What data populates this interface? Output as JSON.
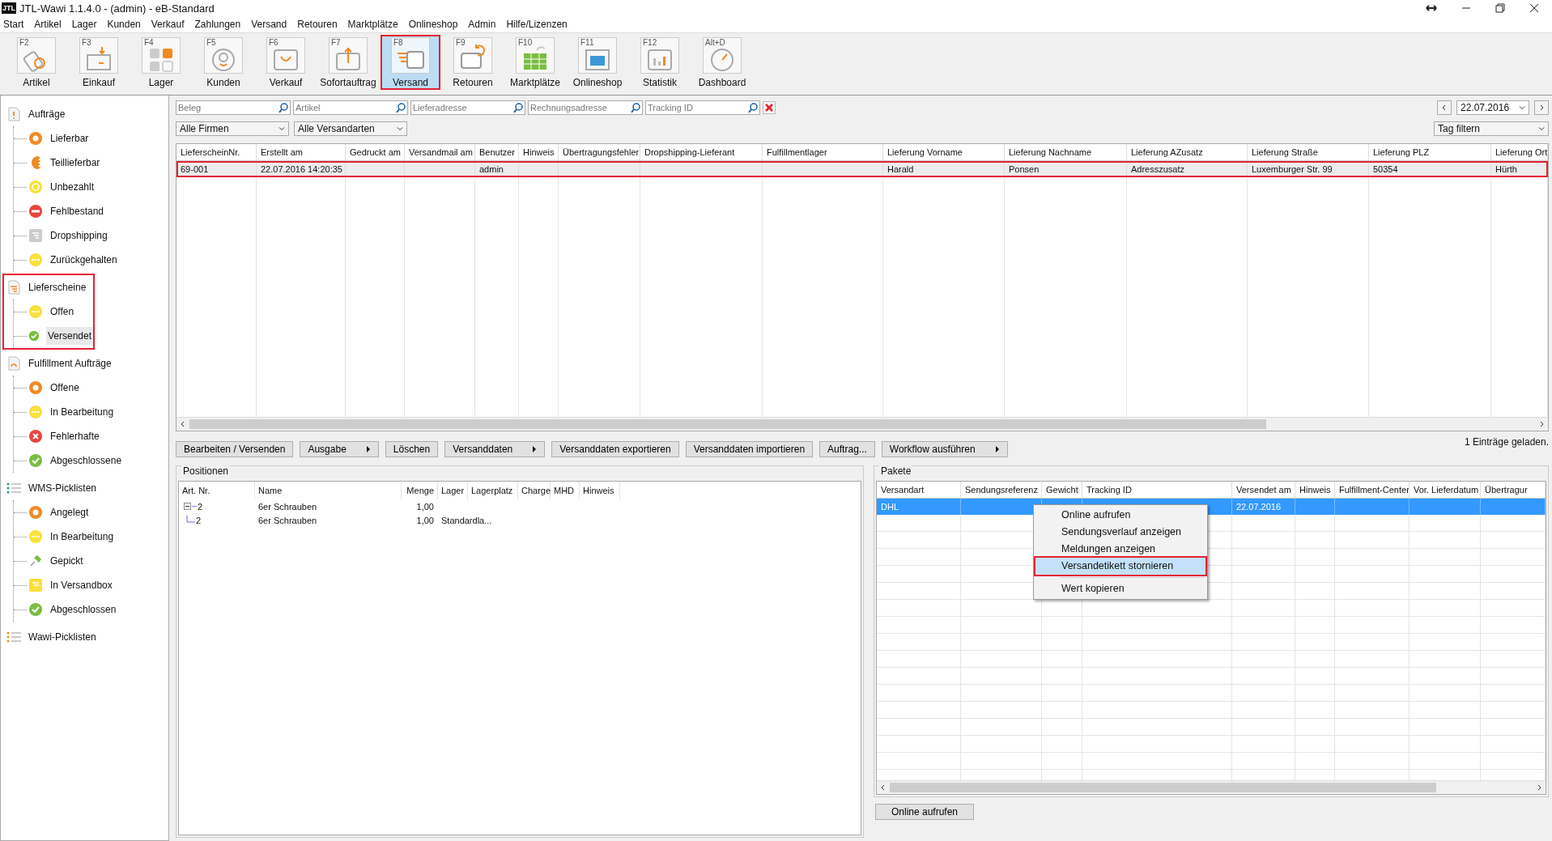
{
  "window": {
    "title": "JTL-Wawi 1.1.4.0 - (admin) - eB-Standard",
    "logo": "JTL"
  },
  "menu": [
    "Start",
    "Artikel",
    "Lager",
    "Kunden",
    "Verkauf",
    "Zahlungen",
    "Versand",
    "Retouren",
    "Marktplätze",
    "Onlineshop",
    "Admin",
    "Hilfe/Lizenzen"
  ],
  "toolbar": [
    {
      "key": "F2",
      "label": "Artikel",
      "selected": false,
      "highlighted": false
    },
    {
      "key": "F3",
      "label": "Einkauf",
      "selected": false,
      "highlighted": false
    },
    {
      "key": "F4",
      "label": "Lager",
      "selected": false,
      "highlighted": false
    },
    {
      "key": "F5",
      "label": "Kunden",
      "selected": false,
      "highlighted": false
    },
    {
      "key": "F6",
      "label": "Verkauf",
      "selected": false,
      "highlighted": false
    },
    {
      "key": "F7",
      "label": "Sofortauftrag",
      "selected": false,
      "highlighted": false
    },
    {
      "key": "F8",
      "label": "Versand",
      "selected": true,
      "highlighted": true
    },
    {
      "key": "F9",
      "label": "Retouren",
      "selected": false,
      "highlighted": false
    },
    {
      "key": "F10",
      "label": "Marktplätze",
      "selected": false,
      "highlighted": false
    },
    {
      "key": "F11",
      "label": "Onlineshop",
      "selected": false,
      "highlighted": false
    },
    {
      "key": "F12",
      "label": "Statistik",
      "selected": false,
      "highlighted": false
    },
    {
      "key": "Alt+D",
      "label": "Dashboard",
      "selected": false,
      "highlighted": false
    }
  ],
  "sidebar": [
    {
      "label": "Aufträge",
      "kind": "doc-alert",
      "highlighted": false,
      "children": [
        {
          "label": "Lieferbar",
          "kind": "ring-orange",
          "selected": false
        },
        {
          "label": "Teillieferbar",
          "kind": "half-orange",
          "selected": false
        },
        {
          "label": "Unbezahlt",
          "kind": "euro-yellow",
          "selected": false
        },
        {
          "label": "Fehlbestand",
          "kind": "minus-red",
          "selected": false
        },
        {
          "label": "Dropshipping",
          "kind": "dropship-gray",
          "selected": false
        },
        {
          "label": "Zurückgehalten",
          "kind": "dots-yellow",
          "selected": false
        }
      ]
    },
    {
      "label": "Lieferscheine",
      "kind": "doc-lines",
      "highlighted": true,
      "children": [
        {
          "label": "Offen",
          "kind": "dots-yellow",
          "selected": false
        },
        {
          "label": "Versendet",
          "kind": "check-green",
          "selected": true
        }
      ]
    },
    {
      "label": "Fulfillment Aufträge",
      "kind": "doc-return",
      "highlighted": false,
      "children": [
        {
          "label": "Offene",
          "kind": "ring-orange",
          "selected": false
        },
        {
          "label": "In Bearbeitung",
          "kind": "dots-yellow",
          "selected": false
        },
        {
          "label": "Fehlerhafte",
          "kind": "cross-red",
          "selected": false
        },
        {
          "label": "Abgeschlossene",
          "kind": "check-green",
          "selected": false
        }
      ]
    },
    {
      "label": "WMS-Picklisten",
      "kind": "list-teal",
      "highlighted": false,
      "children": [
        {
          "label": "Angelegt",
          "kind": "ring-orange",
          "selected": false
        },
        {
          "label": "In Bearbeitung",
          "kind": "dots-yellow",
          "selected": false
        },
        {
          "label": "Gepickt",
          "kind": "pin-green",
          "selected": false
        },
        {
          "label": "In Versandbox",
          "kind": "box-yellow",
          "selected": false
        },
        {
          "label": "Abgeschlossen",
          "kind": "check-green",
          "selected": false
        }
      ]
    },
    {
      "label": "Wawi-Picklisten",
      "kind": "list-orange",
      "highlighted": false
    }
  ],
  "filters": {
    "search": [
      {
        "placeholder": "Beleg"
      },
      {
        "placeholder": "Artikel"
      },
      {
        "placeholder": "Lieferadresse"
      },
      {
        "placeholder": "Rechnungsadresse"
      },
      {
        "placeholder": "Tracking ID"
      }
    ],
    "dropdowns": [
      "Alle Firmen",
      "Alle Versandarten"
    ],
    "date": "22.07.2016",
    "date_filter": "Tag filtern"
  },
  "orders": {
    "columns": [
      "LieferscheinNr.",
      "Erstellt am",
      "Gedruckt am",
      "Versandmail am",
      "Benutzer",
      "Hinweis",
      "Übertragungsfehler",
      "Dropshipping-Lieferant",
      "Fulfillmentlager",
      "Lieferung Vorname",
      "Lieferung Nachname",
      "Lieferung AZusatz",
      "Lieferung Straße",
      "Lieferung PLZ",
      "Lieferung Ort"
    ],
    "rows": [
      {
        "highlighted": true,
        "cells": [
          "69-001",
          "22.07.2016 14:20:35",
          "",
          "",
          "admin",
          "",
          "",
          "",
          "",
          "Harald",
          "Ponsen",
          "Adresszusatz",
          "Luxemburger Str. 99",
          "50354",
          "Hürth"
        ]
      }
    ]
  },
  "actions": [
    {
      "label": "Bearbeiten / Versenden",
      "kind": "plain"
    },
    {
      "label": "Ausgabe",
      "kind": "menu"
    },
    {
      "label": "Löschen",
      "kind": "plain"
    },
    {
      "label": "Versanddaten",
      "kind": "menu"
    },
    {
      "label": "Versanddaten exportieren",
      "kind": "plain"
    },
    {
      "label": "Versanddaten importieren",
      "kind": "plain"
    },
    {
      "label": "Auftrag...",
      "kind": "plain"
    },
    {
      "label": "Workflow ausführen",
      "kind": "menu"
    }
  ],
  "status": "1 Einträge geladen.",
  "positions": {
    "title": "Positionen",
    "columns": [
      "Art. Nr.",
      "Name",
      "Menge",
      "Lager",
      "Lagerplatz",
      "Charge",
      "MHD",
      "Hinweis"
    ],
    "rows": [
      {
        "cells": [
          "2",
          "6er Schrauben",
          "1,00",
          "",
          "",
          "",
          "",
          ""
        ],
        "expanded": true,
        "children": [
          {
            "cells": [
              "2",
              "6er Schrauben",
              "1,00",
              "Standardla...",
              "",
              "",
              "",
              ""
            ]
          }
        ]
      }
    ]
  },
  "packages": {
    "title": "Pakete",
    "columns": [
      "Versandart",
      "Sendungsreferenz",
      "Gewicht",
      "Tracking ID",
      "Versendet am",
      "Hinweis",
      "Fulfillment-Center",
      "Vor. Lieferdatum",
      "Übertragur"
    ],
    "rows": [
      {
        "selected": true,
        "cells": [
          "DHL",
          "",
          "",
          "",
          "22.07.2016",
          "",
          "",
          "",
          ""
        ]
      }
    ],
    "context_menu": [
      {
        "label": "Online aufrufen",
        "selected": false,
        "highlighted": false,
        "separated": false
      },
      {
        "label": "Sendungsverlauf anzeigen",
        "selected": false,
        "highlighted": false,
        "separated": false
      },
      {
        "label": "Meldungen anzeigen",
        "selected": false,
        "highlighted": false,
        "separated": false
      },
      {
        "label": "Versandetikett stornieren",
        "selected": true,
        "highlighted": true,
        "separated": false
      },
      {
        "label": "Wert kopieren",
        "selected": false,
        "highlighted": false,
        "separated": true
      }
    ],
    "button": "Online aufrufen"
  }
}
